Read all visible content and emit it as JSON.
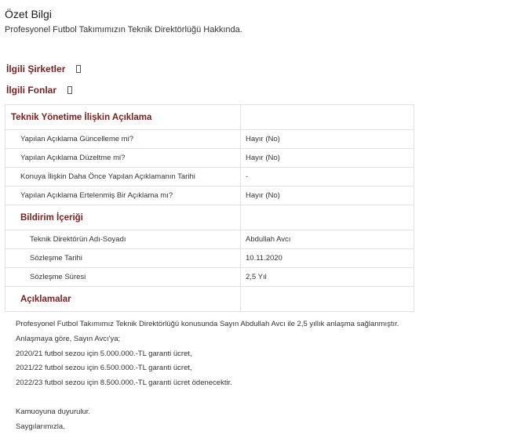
{
  "summary": {
    "title": "Özet Bilgi",
    "subtitle": "Profesyonel Futbol Takımımızın Teknik Direktörlüğü Hakkında."
  },
  "related": {
    "companies_label": "İlgili Şirketler",
    "funds_label": "İlgili Fonlar"
  },
  "disclosure": {
    "section_title": "Teknik Yönetime İlişkin Açıklama",
    "rows": [
      {
        "label": "Yapılan Açıklama Güncelleme mi?",
        "value": "Hayır (No)"
      },
      {
        "label": "Yapılan Açıklama Düzeltme mi?",
        "value": "Hayır (No)"
      },
      {
        "label": "Konuya İlişkin Daha Önce Yapılan Açıklamanın Tarihi",
        "value": "-"
      },
      {
        "label": "Yapılan Açıklama Ertelenmiş Bir Açıklama mı?",
        "value": "Hayır (No)"
      }
    ],
    "content_title": "Bildirim İçeriği",
    "content_rows": [
      {
        "label": "Teknik Direktörün Adı-Soyadı",
        "value": "Abdullah Avcı"
      },
      {
        "label": "Sözleşme Tarihi",
        "value": "10.11.2020"
      },
      {
        "label": "Sözleşme Süresi",
        "value": "2,5 Yıl"
      }
    ],
    "notes_title": "Açıklamalar"
  },
  "notes": {
    "intro": "Profesyonel Futbol Takımımız Teknik Direktörlüğü konusunda Sayın Abdullah Avcı ile 2,5 yıllık anlaşma sağlanmıştır.",
    "lines": [
      "Anlaşmaya göre, Sayın Avcı'ya;",
      "2020/21 futbol sezou için 5.000.000.-TL garanti ücret,",
      "2021/22 futbol sezou için 6.500.000.-TL garanti ücret,",
      "2022/23 futbol sezou için 8.500.000.-TL garanti ücret ödenecektir."
    ],
    "closing": [
      "Kamuoyuna duyurulur.",
      "Saygılarımızla."
    ]
  }
}
